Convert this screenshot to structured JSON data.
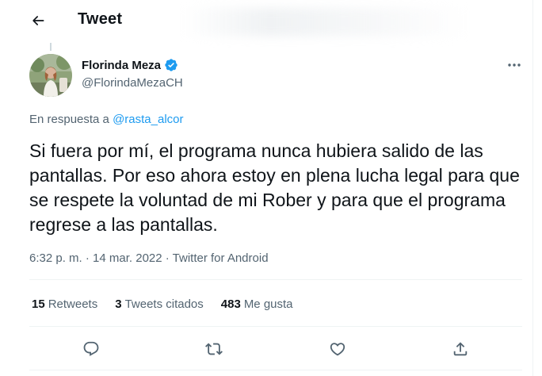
{
  "header": {
    "title": "Tweet"
  },
  "author": {
    "name": "Florinda Meza",
    "handle": "@FlorindaMezaCH"
  },
  "reply": {
    "prefix": "En respuesta a ",
    "handle": "@rasta_alcor"
  },
  "tweet": {
    "text": "Si fuera por mí, el programa nunca hubiera salido de las pantallas. Por eso ahora estoy en plena lucha legal para que se respete la voluntad de mi Rober y para que el programa regrese a las pantallas.",
    "meta": "6:32 p. m. · 14 mar. 2022 · Twitter for Android"
  },
  "stats": {
    "retweets_count": "15",
    "retweets_label": "Retweets",
    "quotes_count": "3",
    "quotes_label": "Tweets citados",
    "likes_count": "483",
    "likes_label": "Me gusta"
  },
  "colors": {
    "accent": "#1d9bf0",
    "text": "#0f1419",
    "secondary": "#536471",
    "border": "#eff3f4"
  },
  "icons": [
    "back-arrow-icon",
    "verified-badge-icon",
    "more-icon",
    "reply-icon",
    "retweet-icon",
    "like-icon",
    "share-icon"
  ]
}
